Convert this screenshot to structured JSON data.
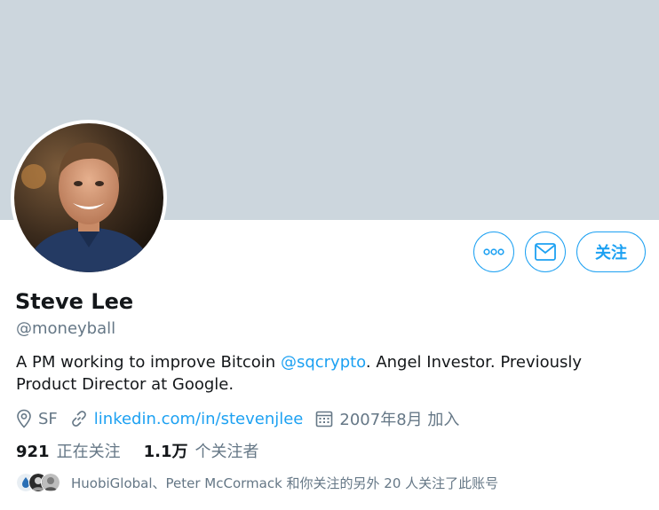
{
  "profile": {
    "name": "Steve Lee",
    "handle": "@moneyball",
    "bio_part1": "A PM working to improve Bitcoin ",
    "bio_mention": "@sqcrypto",
    "bio_part2": ". Angel Investor. Previously Product Director at Google."
  },
  "meta": {
    "location": "SF",
    "website": "linkedin.com/in/stevenjlee",
    "joined": "2007年8月 加入"
  },
  "stats": {
    "following_count": "921",
    "following_label": "正在关注",
    "followers_count": "1.1万",
    "followers_label": "个关注者"
  },
  "followers_you_know": {
    "text": "HuobiGlobal、Peter McCormack 和你关注的另外 20 人关注了此账号"
  },
  "actions": {
    "more_icon": "more-dots-icon",
    "message_icon": "envelope-icon",
    "follow_label": "关注"
  },
  "colors": {
    "accent": "#1da1f2",
    "banner": "#ccd6dd",
    "secondary_text": "#657786"
  }
}
